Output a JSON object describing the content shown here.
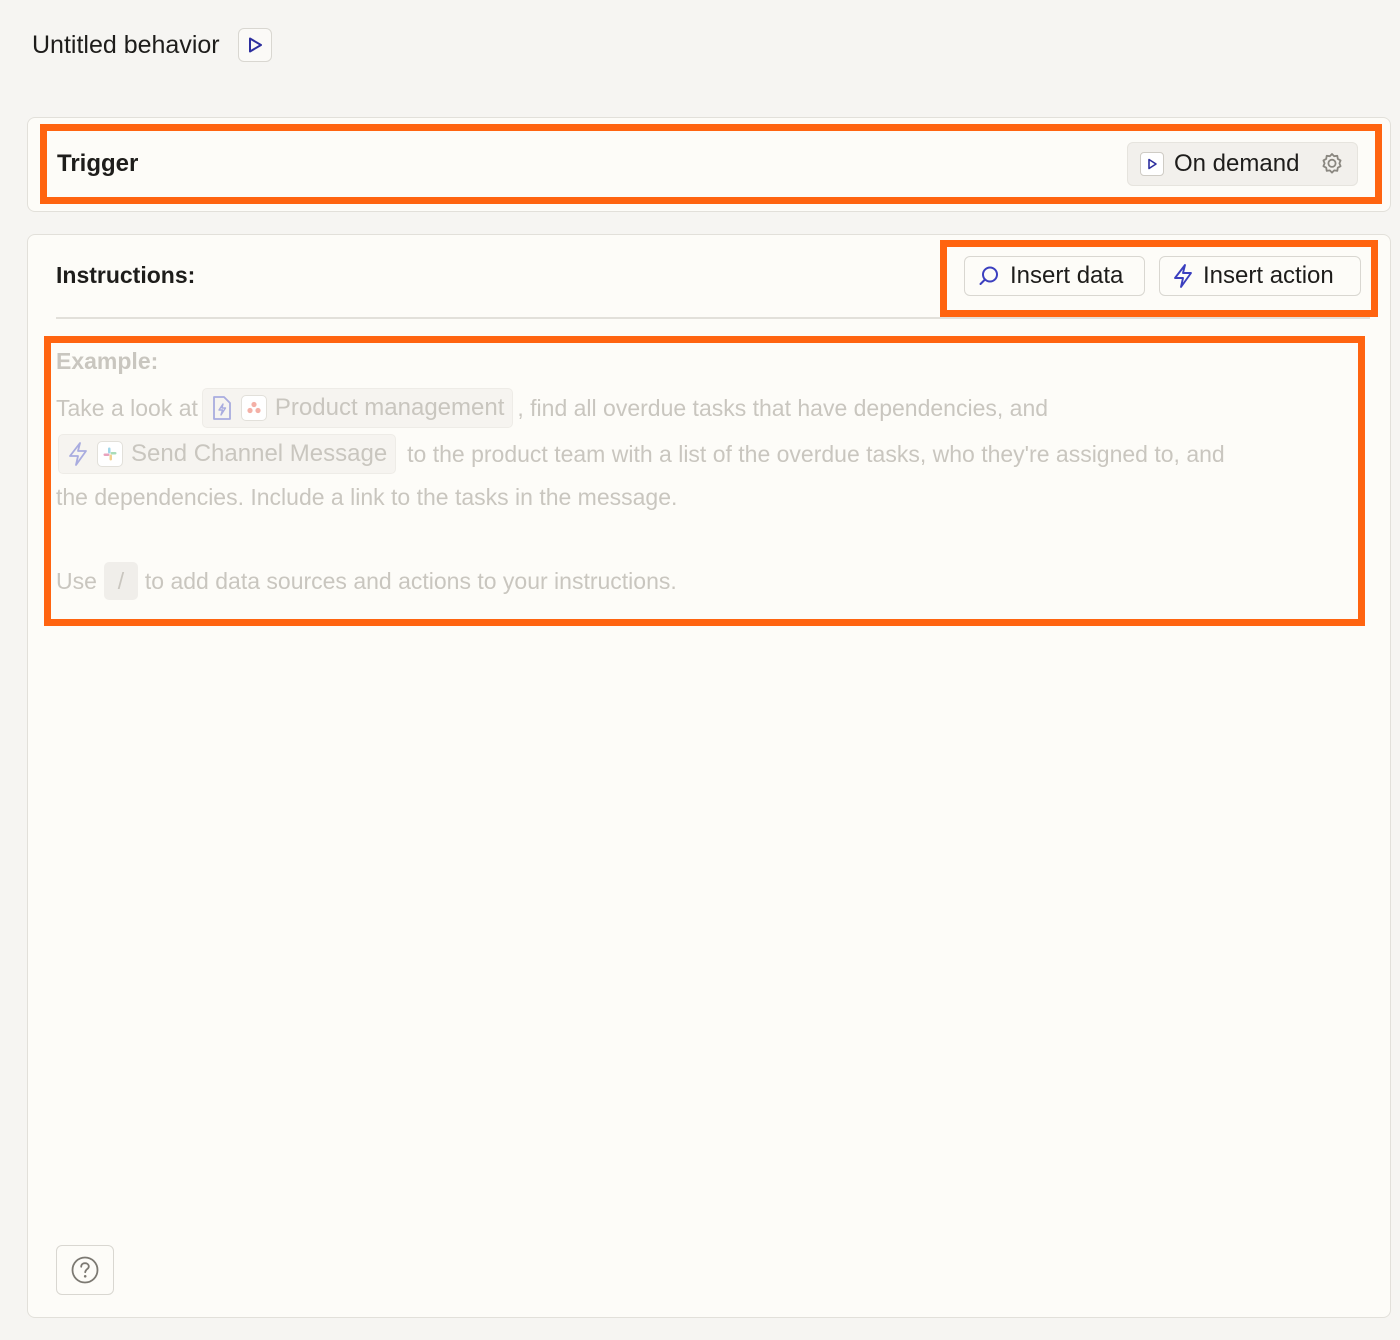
{
  "header": {
    "title": "Untitled behavior",
    "run_icon": "play-icon"
  },
  "trigger": {
    "label": "Trigger",
    "mode_label": "On demand",
    "mode_icon": "play-icon",
    "settings_icon": "gear-icon"
  },
  "instructions": {
    "label": "Instructions:",
    "insert_data_label": "Insert data",
    "insert_data_icon": "search-icon",
    "insert_action_label": "Insert action",
    "insert_action_icon": "lightning-icon"
  },
  "example": {
    "heading": "Example:",
    "line1_prefix": "Take a look at",
    "data_chip_label": "Product management",
    "line1_suffix": ", find all overdue tasks that have dependencies, and",
    "action_chip_label": "Send Channel Message",
    "line2_suffix": "to the product team with a list of the overdue tasks, who they're assigned to, and",
    "line3": "the dependencies. Include a link to the tasks in the message.",
    "hint_prefix": "Use",
    "hint_key": "/",
    "hint_suffix": "to add data sources and actions to your instructions."
  },
  "footer": {
    "help_icon": "help-icon"
  },
  "colors": {
    "highlight": "#ff6410",
    "accent_icon": "#3b3fbf",
    "placeholder_text": "#c9c6bf"
  }
}
